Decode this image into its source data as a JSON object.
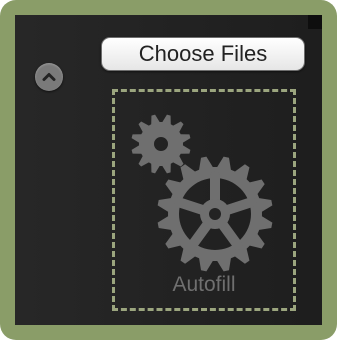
{
  "upload": {
    "choose_files_label": "Choose Files",
    "dropzone_label": "Autofill"
  },
  "icons": {
    "collapse": "chevron-up-icon",
    "settings": "gears-icon"
  },
  "colors": {
    "frame": "#8a9d68",
    "panel": "#232323",
    "dropzone_border": "#9ba57e",
    "gear": "#6f6f6f"
  }
}
